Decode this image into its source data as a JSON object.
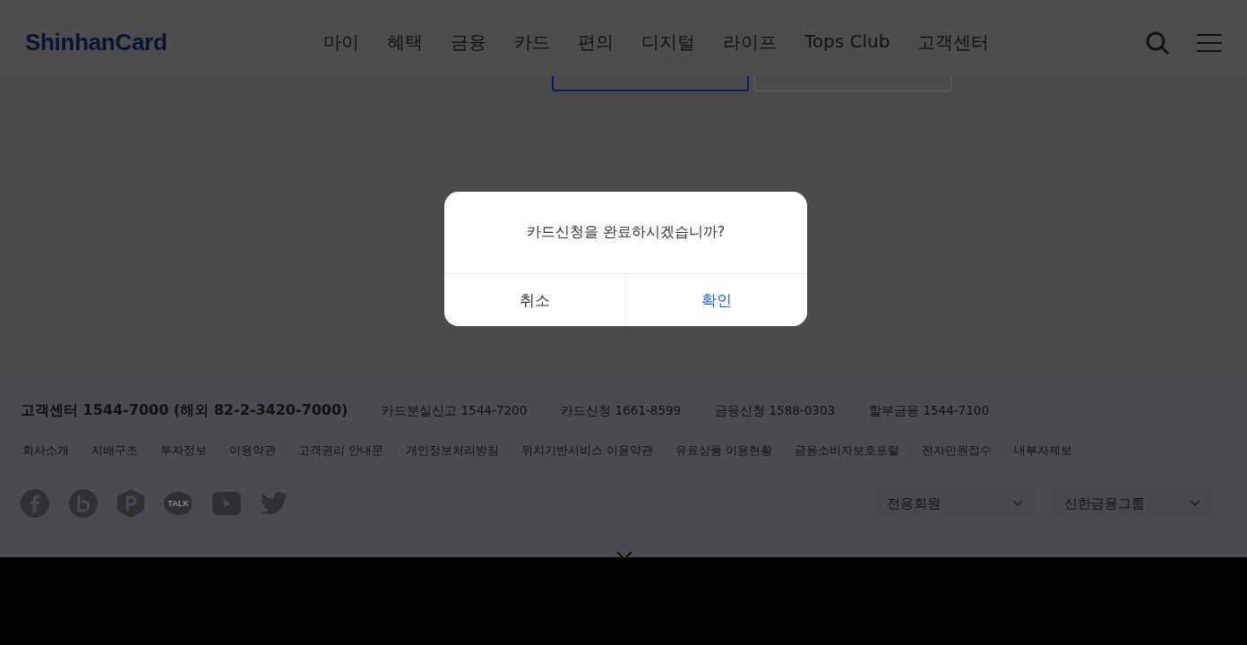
{
  "header": {
    "logo": "ShinhanCard",
    "nav": [
      "마이",
      "혜택",
      "금융",
      "카드",
      "편의",
      "디지털",
      "라이프",
      "Tops Club",
      "고객센터"
    ]
  },
  "step_tabs": [
    {
      "selected": true
    },
    {
      "selected": false
    }
  ],
  "dialog": {
    "message": "카드신청을 완료하시겠습니까?",
    "buttons": [
      {
        "label": "취소",
        "kind": "cancel"
      },
      {
        "label": "확인",
        "kind": "confirm"
      }
    ]
  },
  "footer": {
    "main_contact": "고객센터 1544-7000 (해외 82-2-3420-7000)",
    "contacts": [
      "카드분실신고 1544-7200",
      "카드신청 1661-8599",
      "금융신청 1588-0303",
      "할부금융 1544-7100"
    ],
    "links": [
      "회사소개",
      "지배구조",
      "투자정보",
      "이용약관",
      "고객권리 안내문",
      "개인정보처리방침",
      "위치기반서비스 이용약관",
      "유료상품 이용현황",
      "금융소비자보호포털",
      "전자민원접수",
      "내부자제보"
    ],
    "social": [
      {
        "kind": "facebook"
      },
      {
        "kind": "blog"
      },
      {
        "kind": "post"
      },
      {
        "kind": "talk",
        "label": "TALK"
      },
      {
        "kind": "youtube"
      },
      {
        "kind": "twitter"
      }
    ],
    "selects": [
      "전용회원",
      "신한금융그룹"
    ]
  }
}
